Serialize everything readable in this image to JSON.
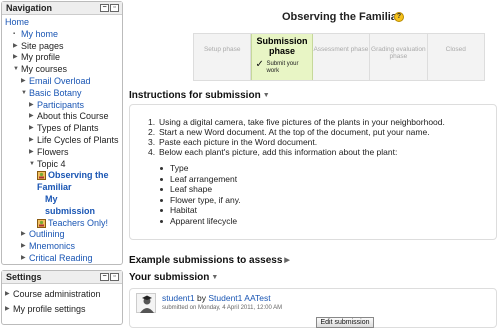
{
  "navigation": {
    "title": "Navigation",
    "items": [
      {
        "label": "Home",
        "indent": 0,
        "tri": "",
        "style": "link"
      },
      {
        "label": "My home",
        "indent": 1,
        "tri": "dot",
        "style": "link"
      },
      {
        "label": "Site pages",
        "indent": 1,
        "tri": "right",
        "style": "plain"
      },
      {
        "label": "My profile",
        "indent": 1,
        "tri": "right",
        "style": "plain"
      },
      {
        "label": "My courses",
        "indent": 1,
        "tri": "down",
        "style": "plain"
      },
      {
        "label": "Email Overload",
        "indent": 2,
        "tri": "right",
        "style": "link"
      },
      {
        "label": "Basic Botany",
        "indent": 2,
        "tri": "down",
        "style": "link"
      },
      {
        "label": "Participants",
        "indent": 3,
        "tri": "right",
        "style": "link"
      },
      {
        "label": "About this Course",
        "indent": 3,
        "tri": "right",
        "style": "plain"
      },
      {
        "label": "Types of Plants",
        "indent": 3,
        "tri": "right",
        "style": "plain"
      },
      {
        "label": "Life Cycles of Plants",
        "indent": 3,
        "tri": "right",
        "style": "plain"
      },
      {
        "label": "Flowers",
        "indent": 3,
        "tri": "right",
        "style": "plain"
      },
      {
        "label": "Topic 4",
        "indent": 3,
        "tri": "down",
        "style": "plain"
      },
      {
        "label": "Observing the",
        "indent": 4,
        "tri": "icon",
        "style": "active"
      },
      {
        "label": "Familiar",
        "indent": 4,
        "tri": "",
        "style": "active"
      },
      {
        "label": "My",
        "indent": 5,
        "tri": "",
        "style": "active"
      },
      {
        "label": "submission",
        "indent": 5,
        "tri": "",
        "style": "active"
      },
      {
        "label": "Teachers Only!",
        "indent": 4,
        "tri": "icon",
        "style": "link"
      },
      {
        "label": "Outlining",
        "indent": 2,
        "tri": "right",
        "style": "link"
      },
      {
        "label": "Mnemonics",
        "indent": 2,
        "tri": "right",
        "style": "link"
      },
      {
        "label": "Critical Reading",
        "indent": 2,
        "tri": "right",
        "style": "link"
      }
    ]
  },
  "settings": {
    "title": "Settings",
    "items": [
      {
        "label": "Course administration",
        "tri": "right"
      },
      {
        "label": "My profile settings",
        "tri": "right"
      }
    ]
  },
  "main": {
    "title": "Observing the Familiar",
    "phases": [
      {
        "name": "Setup phase",
        "active": false
      },
      {
        "name": "Submission phase",
        "active": true,
        "task": "Submit your work"
      },
      {
        "name": "Assessment phase",
        "active": false
      },
      {
        "name": "Grading evaluation phase",
        "active": false
      },
      {
        "name": "Closed",
        "active": false
      }
    ],
    "instructions_heading": "Instructions for submission",
    "steps": [
      "Using a digital camera, take five pictures of the plants in your neighborhood.",
      "Start a new Word document. At the top of the document, put your name.",
      "Paste each picture in the Word document.",
      "Below each plant's picture, add this information about the plant:"
    ],
    "bullets": [
      "Type",
      "Leaf arrangement",
      "Leaf shape",
      "Flower type, if any.",
      "Habitat",
      "Apparent lifecycle"
    ],
    "example_heading": "Example submissions to assess",
    "your_submission_heading": "Your submission",
    "submission": {
      "title": "student1",
      "by": "by",
      "author": "Student1 AATest",
      "submitted_text": "submitted on Monday, 4 April 2011, 12:00 AM",
      "edit_label": "Edit submission"
    }
  },
  "colors": {
    "link": "#1a56b4",
    "active_phase": "#e8f5c5",
    "help_icon": "#f6c21b"
  },
  "icons": [
    "block-dock-icon",
    "block-hide-icon",
    "help-icon",
    "expand-arrow-icon",
    "activity-icon",
    "user-avatar-icon"
  ]
}
